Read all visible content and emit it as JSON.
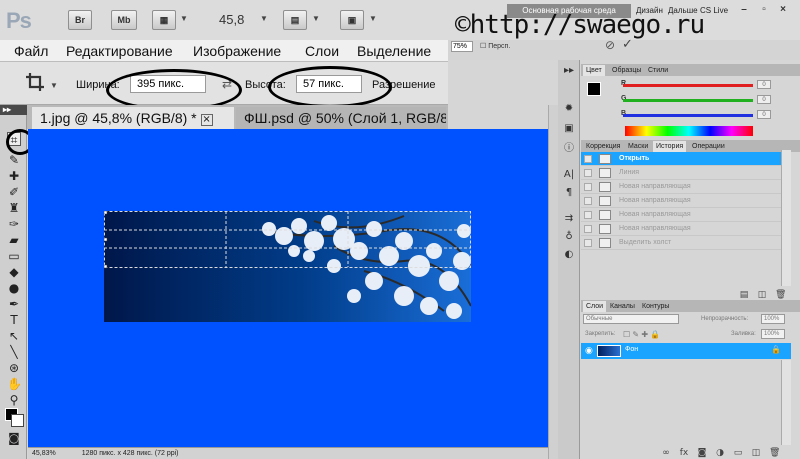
{
  "app": {
    "logo": "Ps",
    "bridge_btn": "Br",
    "minibridge_btn": "Mb",
    "zoom_value": "45,8",
    "workspace_btn": "Основная рабочая среда",
    "workspace_design": "Дизайн",
    "workspace_more": "Дальше",
    "cs_live": "CS Live"
  },
  "watermark": "©http://swaego.ru",
  "menu": [
    "Файл",
    "Редактирование",
    "Изображение",
    "Слои",
    "Выделение"
  ],
  "right_strip": {
    "percent": "75%",
    "perspective_label": "Персп."
  },
  "options": {
    "width_label": "Ширина:",
    "width_value": "395 пикс.",
    "height_label": "Высота:",
    "height_value": "57 пикс.",
    "resolution_label": "Разрешение"
  },
  "tabs": [
    {
      "label": "1.jpg @ 45,8% (RGB/8) *"
    },
    {
      "label": "ФШ.psd @ 50% (Слой 1, RGB/8) *"
    }
  ],
  "status": {
    "zoom": "45,83%",
    "doc": "1280 пикс. x 428 пикс. (72 ppi)"
  },
  "panels": {
    "color_tabs": [
      "Цвет",
      "Образцы",
      "Стили"
    ],
    "color_sliders": [
      {
        "label": "R",
        "value": "0",
        "color": "#e02020"
      },
      {
        "label": "G",
        "value": "0",
        "color": "#20b020"
      },
      {
        "label": "B",
        "value": "0",
        "color": "#2030e0"
      }
    ],
    "history_tabs": [
      "Коррекция",
      "Маски",
      "История",
      "Операции"
    ],
    "history_items": [
      {
        "label": "Открыть",
        "active": true
      },
      {
        "label": "Линия",
        "active": false
      },
      {
        "label": "Новая направляющая",
        "active": false
      },
      {
        "label": "Новая направляющая",
        "active": false
      },
      {
        "label": "Новая направляющая",
        "active": false
      },
      {
        "label": "Новая направляющая",
        "active": false
      },
      {
        "label": "Выделить холст",
        "active": false
      }
    ],
    "layers_tabs": [
      "Слои",
      "Каналы",
      "Контуры"
    ],
    "blend_mode": "Обычные",
    "opacity_label": "Непрозрачность:",
    "opacity_value": "100%",
    "lock_label": "Закрепить:",
    "fill_label": "Заливка:",
    "fill_value": "100%",
    "layer_name": "Фон"
  },
  "colors": {
    "canvas_bg": "#0051ff",
    "selection": "#1aa3ff"
  }
}
